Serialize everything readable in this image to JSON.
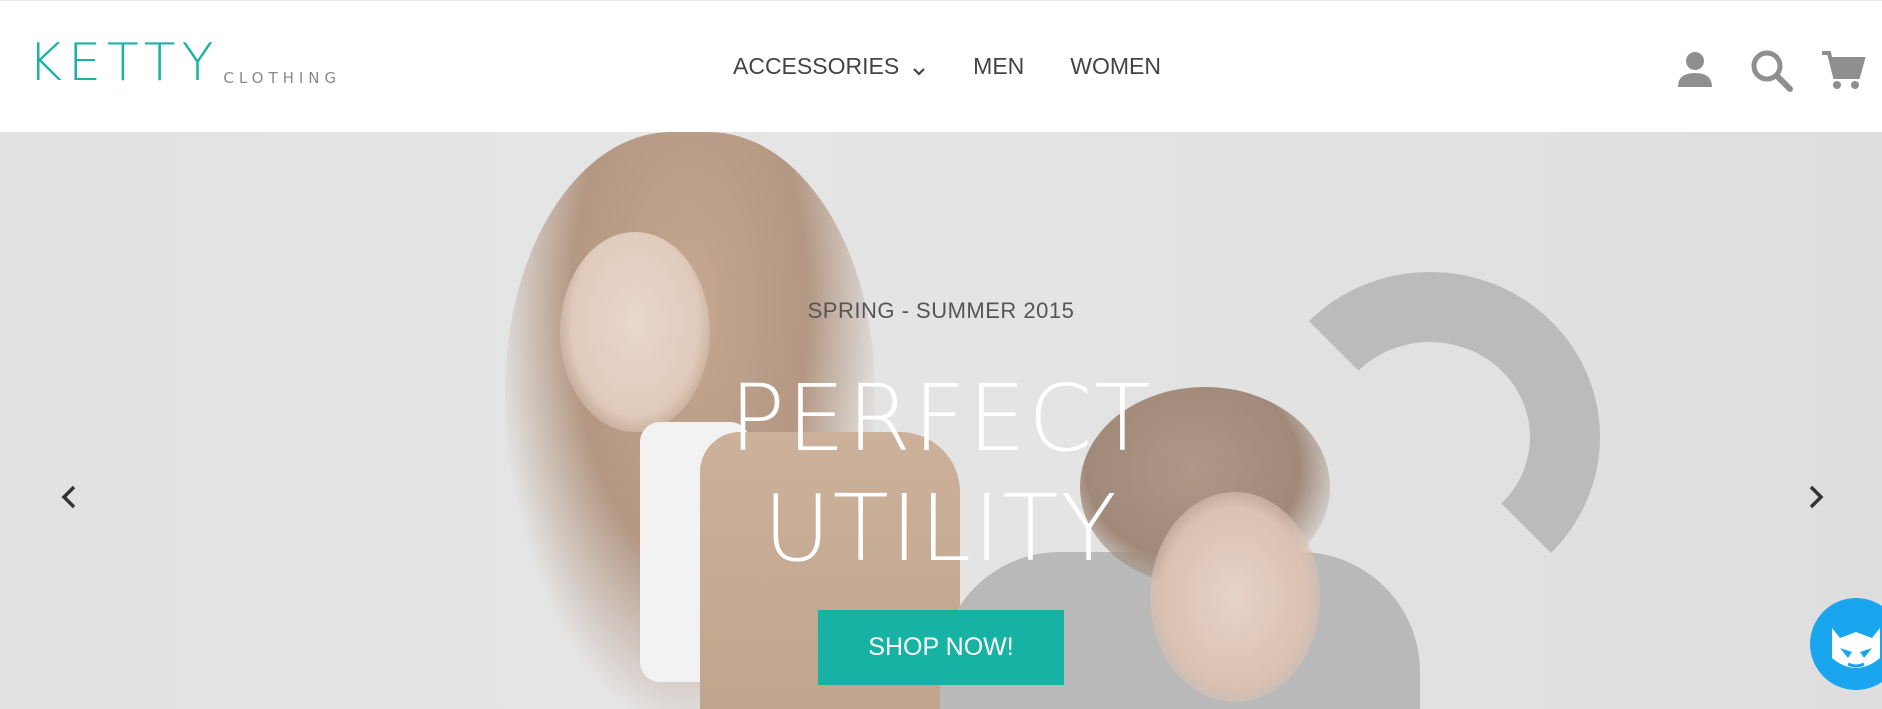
{
  "brand": {
    "name": "KETTY",
    "tagline": "CLOTHING",
    "color": "#1ab3a5"
  },
  "nav": {
    "items": [
      {
        "label": "ACCESSORIES",
        "has_dropdown": true,
        "icon": "chevron-down-icon"
      },
      {
        "label": "MEN"
      },
      {
        "label": "WOMEN"
      }
    ]
  },
  "actions": {
    "account_icon": "user-icon",
    "search_icon": "search-icon",
    "cart_icon": "cart-icon",
    "icon_color": "#8f8f8f"
  },
  "hero": {
    "season": "SPRING - SUMMER 2015",
    "headline_line1": "PERFECT",
    "headline_line2": "UTILITY",
    "cta_label": "SHOP NOW!",
    "cta_color": "#16b2a3",
    "prev_icon": "chevron-left-icon",
    "next_icon": "chevron-right-icon"
  },
  "chat": {
    "icon": "mascot-icon",
    "color": "#1aa6ef"
  }
}
